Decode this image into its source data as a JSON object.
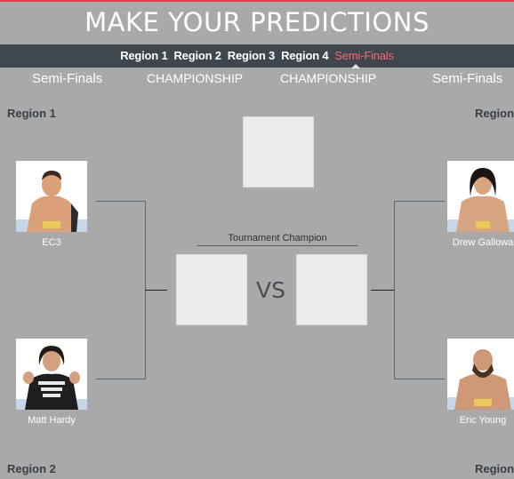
{
  "header": {
    "title": "MAKE YOUR PREDICTIONS"
  },
  "nav": {
    "items": [
      {
        "label": "Region 1"
      },
      {
        "label": "Region 2"
      },
      {
        "label": "Region 3"
      },
      {
        "label": "Region 4"
      },
      {
        "label": "Semi-Finals",
        "active": true
      }
    ],
    "active_color": "#f06a70"
  },
  "columns": [
    "Semi-Finals",
    "CHAMPIONSHIP",
    "CHAMPIONSHIP",
    "Semi-Finals"
  ],
  "regions": {
    "top_left": "Region 1",
    "bottom_left": "Region 2",
    "top_right": "Region",
    "bottom_right": "Region"
  },
  "wrestlers": {
    "left_top": {
      "name": "EC3"
    },
    "left_bottom": {
      "name": "Matt Hardy"
    },
    "right_top": {
      "name": "Drew Gallowa"
    },
    "right_bottom": {
      "name": "Eric Young"
    }
  },
  "center": {
    "champion_label": "Tournament Champion",
    "vs": "VS"
  },
  "colors": {
    "background": "#a9a9a9",
    "navbar": "#3f464d",
    "accent": "#e43b48"
  }
}
